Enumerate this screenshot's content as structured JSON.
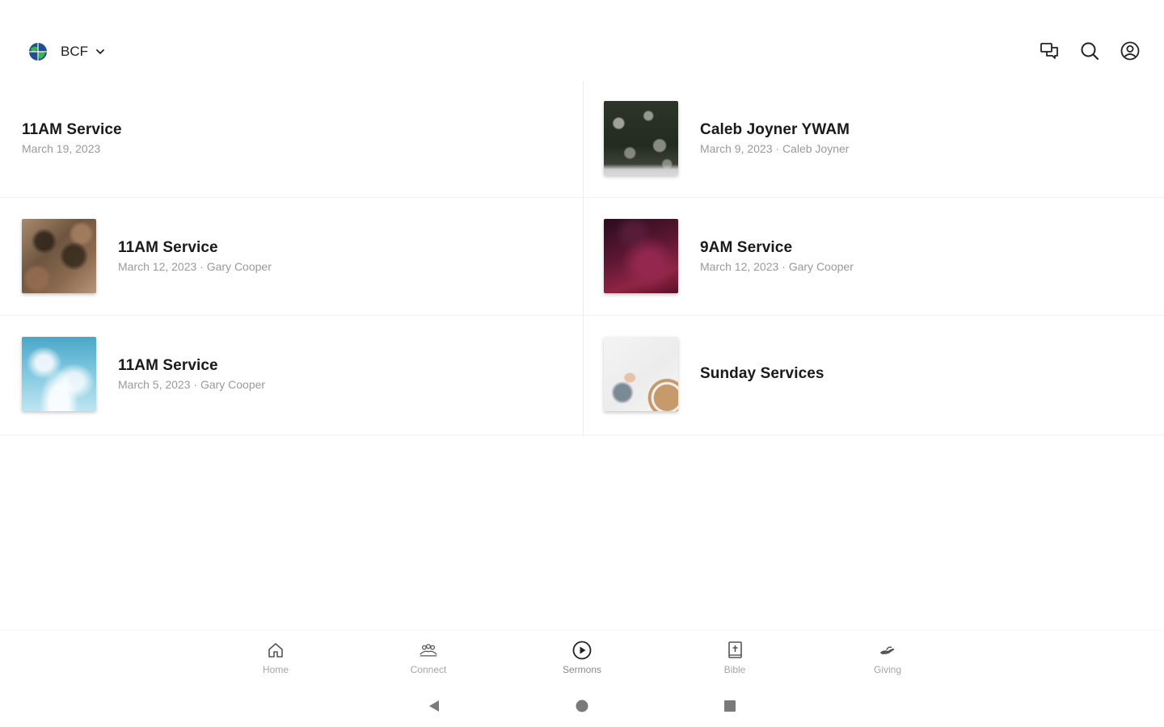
{
  "header": {
    "org_name": "BCF",
    "logo_icon": "globe-logo-icon",
    "actions": [
      {
        "name": "chat-icon"
      },
      {
        "name": "search-icon"
      },
      {
        "name": "account-icon"
      }
    ]
  },
  "sermons": [
    {
      "title": "11AM Service",
      "subtitle": "March 19, 2023",
      "thumbnail": "none"
    },
    {
      "title": "Caleb Joyner YWAM",
      "subtitle": "March 9, 2023 · Caleb Joyner",
      "thumbnail": "forest"
    },
    {
      "title": "11AM Service",
      "subtitle": "March 12, 2023 · Gary Cooper",
      "thumbnail": "desert"
    },
    {
      "title": "9AM Service",
      "subtitle": "March 12, 2023 · Gary Cooper",
      "thumbnail": "purple-abstract"
    },
    {
      "title": "11AM Service",
      "subtitle": "March 5, 2023 · Gary Cooper",
      "thumbnail": "sky"
    },
    {
      "title": "Sunday Services",
      "subtitle": "",
      "thumbnail": "desk-hat"
    }
  ],
  "bottom_nav": {
    "items": [
      {
        "label": "Home",
        "icon": "home-icon",
        "active": false
      },
      {
        "label": "Connect",
        "icon": "people-icon",
        "active": false
      },
      {
        "label": "Sermons",
        "icon": "play-circle-icon",
        "active": true
      },
      {
        "label": "Bible",
        "icon": "bible-icon",
        "active": false
      },
      {
        "label": "Giving",
        "icon": "giving-hand-icon",
        "active": false
      }
    ]
  },
  "system_bar": {
    "buttons": [
      "back-icon",
      "home-circle-icon",
      "recents-square-icon"
    ]
  },
  "colors": {
    "background": "#ffffff",
    "title_text": "#1a1a1a",
    "subtitle_text": "#9a9a9a",
    "nav_label": "#a5a5a5"
  }
}
